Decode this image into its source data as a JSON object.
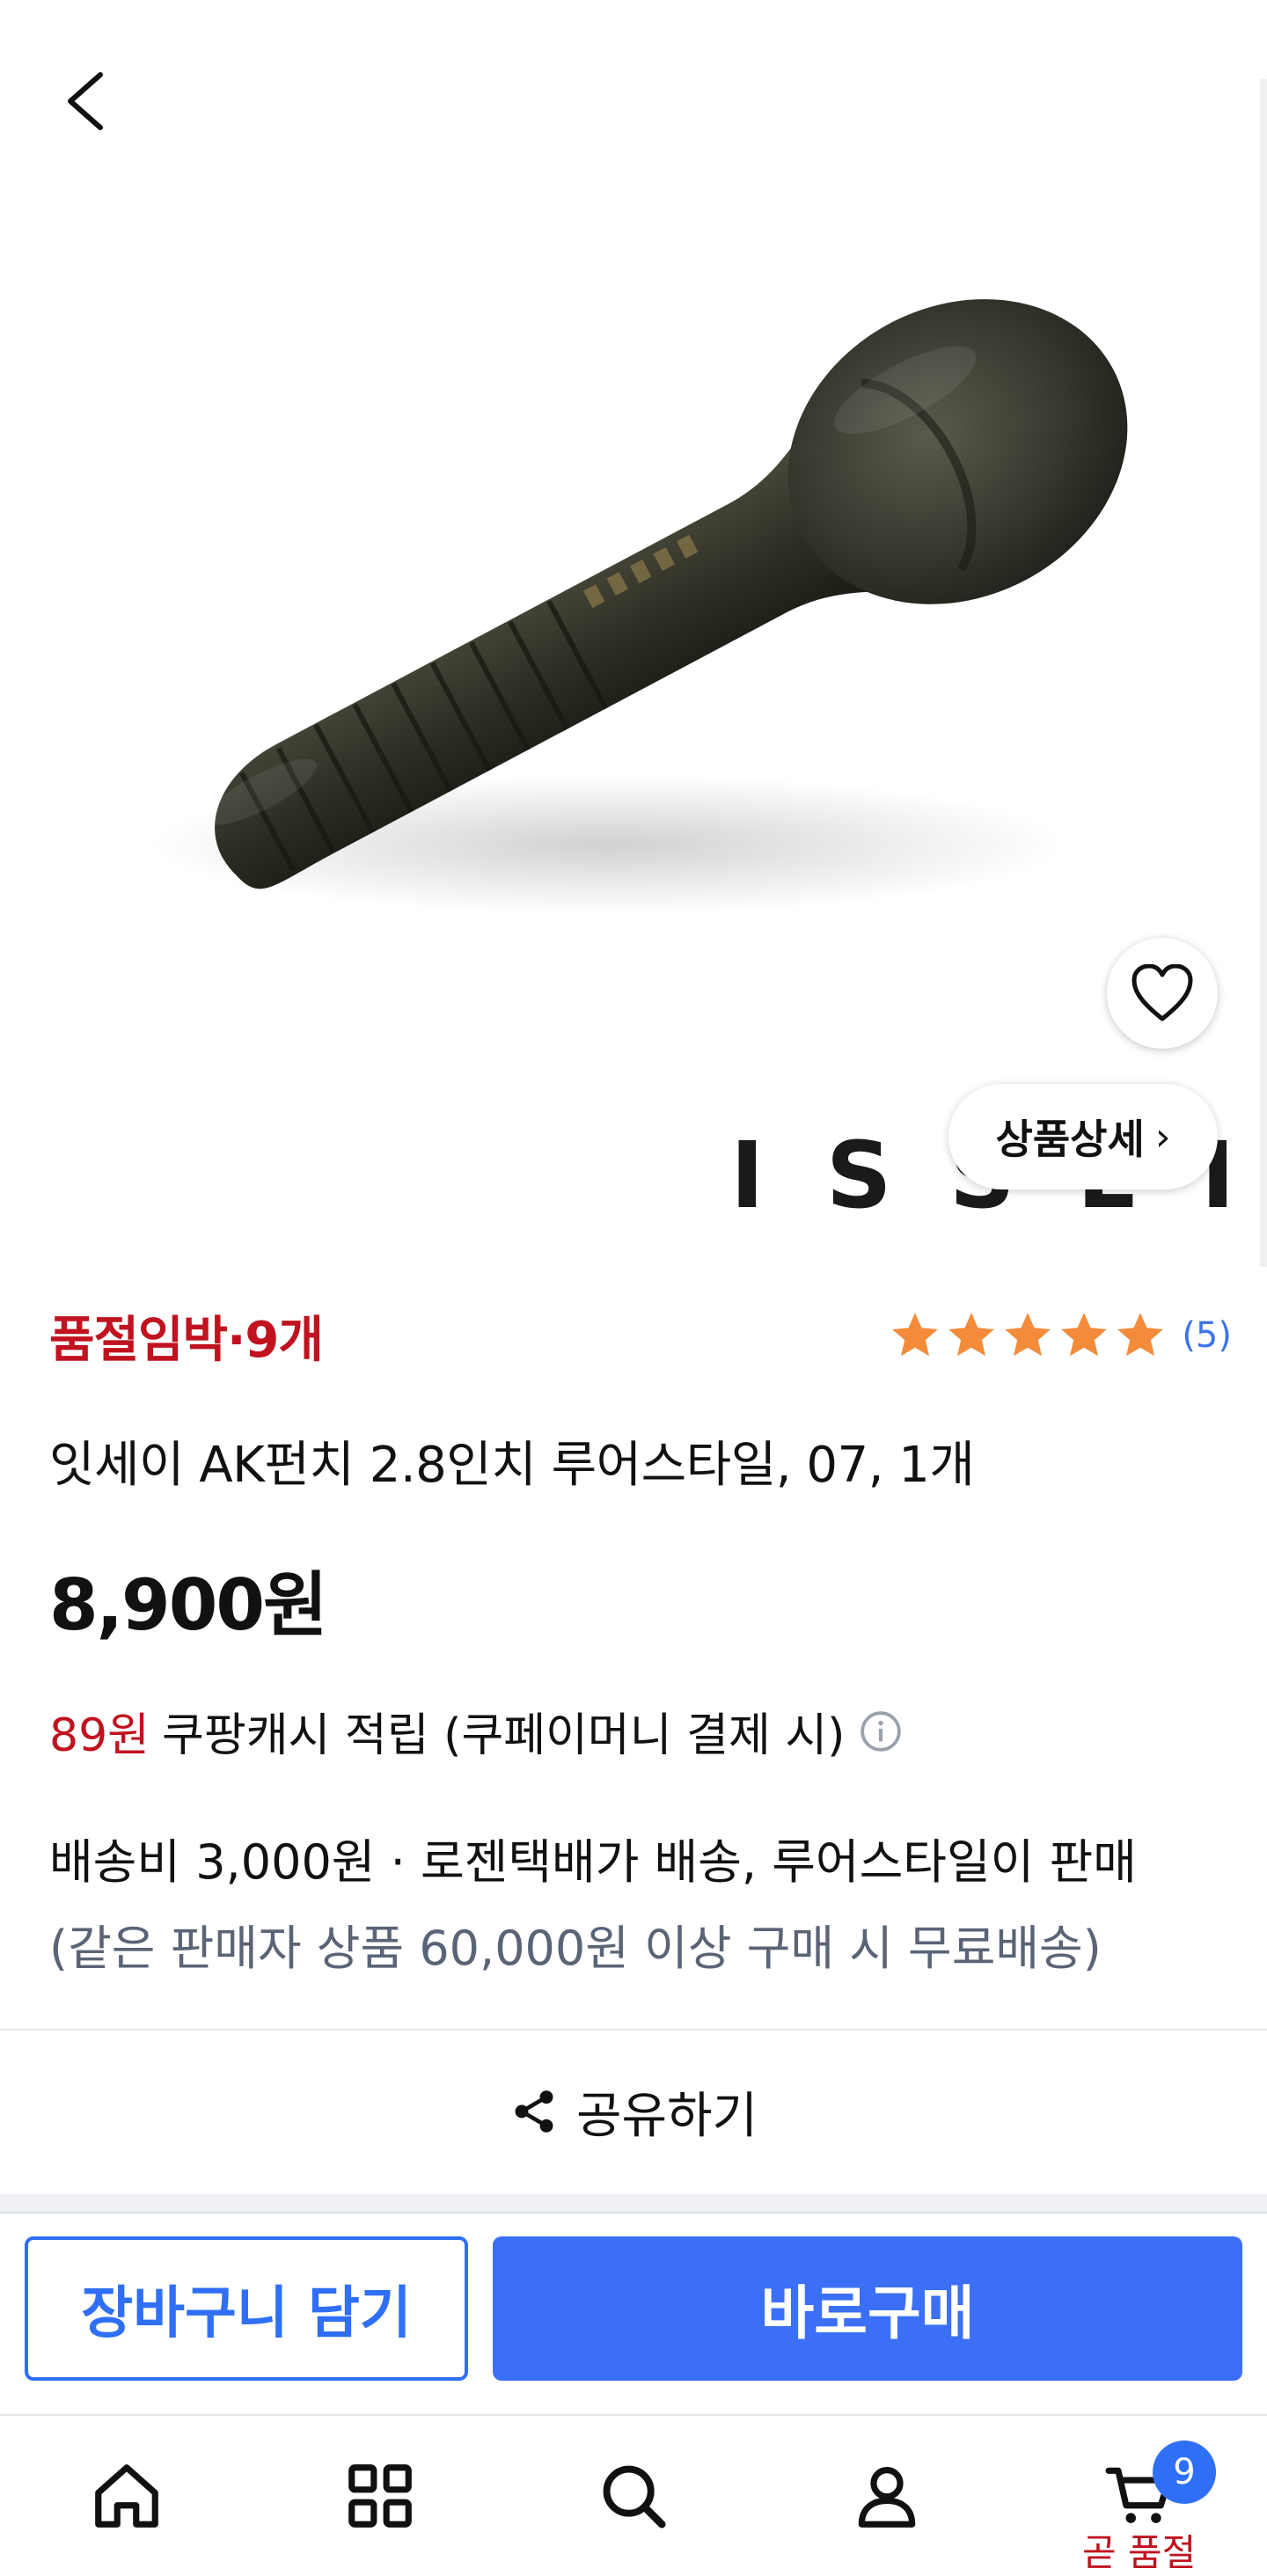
{
  "header": {
    "back_icon": "chevron-left-icon"
  },
  "hero": {
    "wishlist_icon": "heart-icon",
    "detail_button_label": "상품상세",
    "detail_chevron": "›",
    "brand_watermark": "ISSEI"
  },
  "product": {
    "stock_badge": "품절임박·9개",
    "rating": {
      "stars": 5,
      "max": 5,
      "review_count": "(5)"
    },
    "title": "잇세이 AK펀치 2.8인치 루어스타일, 07, 1개",
    "price": "8,900원",
    "cashback": {
      "amount": "89원",
      "text": "쿠팡캐시 적립 (쿠페이머니 결제 시)"
    },
    "shipping": {
      "line": "배송비 3,000원 · 로젠택배가 배송, 루어스타일이 판매",
      "note": "(같은 판매자 상품 60,000원 이상 구매 시 무료배송)"
    }
  },
  "share": {
    "label": "공유하기"
  },
  "actions": {
    "cart_label": "장바구니 담기",
    "buy_label": "바로구매"
  },
  "tabbar": {
    "items": [
      {
        "icon": "home-icon"
      },
      {
        "icon": "grid-icon"
      },
      {
        "icon": "search-icon"
      },
      {
        "icon": "user-icon"
      },
      {
        "icon": "cart-icon"
      }
    ],
    "cart_badge": "9",
    "cart_status": "곧 품절"
  },
  "colors": {
    "accent_blue": "#3b6ff6",
    "warning_red": "#c0121f",
    "star_orange": "#f48b3a",
    "review_blue": "#3f74e8",
    "muted_text": "#5a6476"
  }
}
